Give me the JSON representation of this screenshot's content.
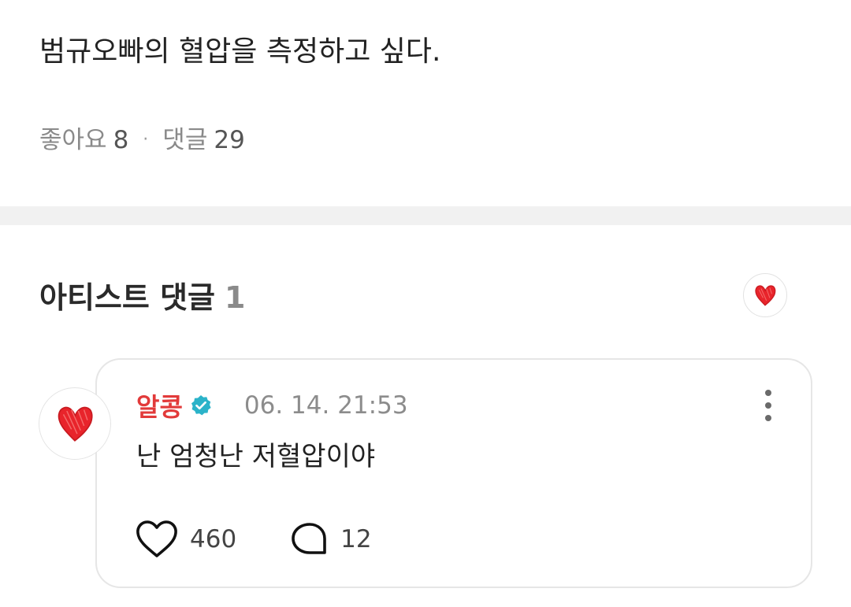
{
  "post": {
    "text": "범규오빠의 혈압을 측정하고 싶다.",
    "likes_label": "좋아요",
    "likes_count": "8",
    "separator": "·",
    "comments_label": "댓글",
    "comments_count": "29"
  },
  "artist_comments": {
    "title": "아티스트 댓글",
    "count": "1",
    "avatar_icon": "red-heart-icon"
  },
  "comment": {
    "author": "알콩",
    "verified_icon": "verified-badge-icon",
    "timestamp": "06. 14. 21:53",
    "body": "난 엄청난 저혈압이야",
    "like_icon": "heart-outline-icon",
    "like_count": "460",
    "reply_icon": "speech-bubble-icon",
    "reply_count": "12",
    "more_icon": "more-vertical-icon"
  },
  "colors": {
    "author": "#e23a3a",
    "verified": "#2bb3c9",
    "heart": "#e8242b",
    "muted_text": "#8a8a8a",
    "divider": "#f1f1f1"
  }
}
